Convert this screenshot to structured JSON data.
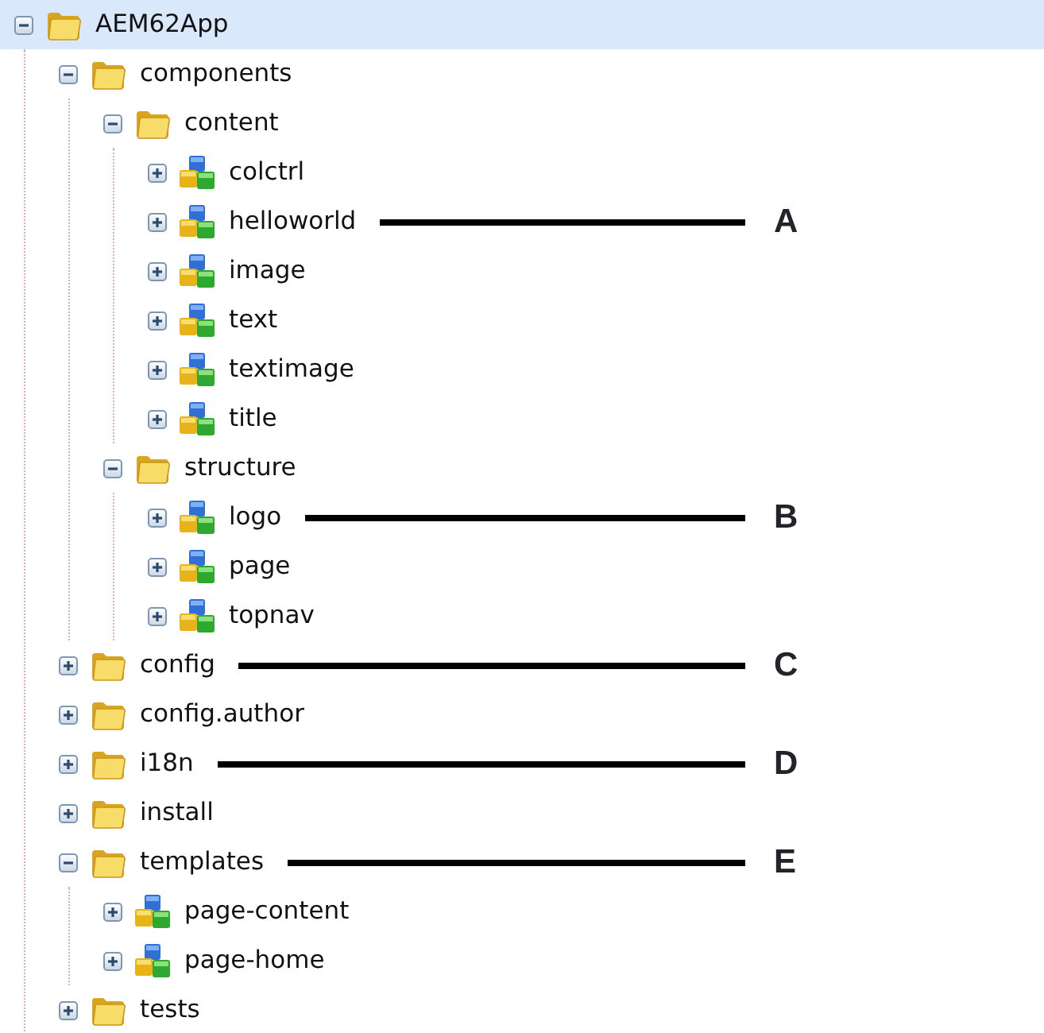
{
  "tree": [
    {
      "label": "AEM62App",
      "kind": "folder",
      "expanded": true,
      "selected": true,
      "children": [
        {
          "label": "components",
          "kind": "folder",
          "expanded": true,
          "selected": false,
          "children": [
            {
              "label": "content",
              "kind": "folder",
              "expanded": true,
              "selected": false,
              "children": [
                {
                  "label": "colctrl",
                  "kind": "component",
                  "expanded": false,
                  "selected": false
                },
                {
                  "label": "helloworld",
                  "kind": "component",
                  "expanded": false,
                  "selected": false,
                  "annotation": "A"
                },
                {
                  "label": "image",
                  "kind": "component",
                  "expanded": false,
                  "selected": false
                },
                {
                  "label": "text",
                  "kind": "component",
                  "expanded": false,
                  "selected": false
                },
                {
                  "label": "textimage",
                  "kind": "component",
                  "expanded": false,
                  "selected": false
                },
                {
                  "label": "title",
                  "kind": "component",
                  "expanded": false,
                  "selected": false
                }
              ]
            },
            {
              "label": "structure",
              "kind": "folder",
              "expanded": true,
              "selected": false,
              "children": [
                {
                  "label": "logo",
                  "kind": "component",
                  "expanded": false,
                  "selected": false,
                  "annotation": "B"
                },
                {
                  "label": "page",
                  "kind": "component",
                  "expanded": false,
                  "selected": false
                },
                {
                  "label": "topnav",
                  "kind": "component",
                  "expanded": false,
                  "selected": false
                }
              ]
            }
          ]
        },
        {
          "label": "config",
          "kind": "folder",
          "expanded": false,
          "selected": false,
          "annotation": "C"
        },
        {
          "label": "config.author",
          "kind": "folder",
          "expanded": false,
          "selected": false
        },
        {
          "label": "i18n",
          "kind": "folder",
          "expanded": false,
          "selected": false,
          "annotation": "D"
        },
        {
          "label": "install",
          "kind": "folder",
          "expanded": false,
          "selected": false
        },
        {
          "label": "templates",
          "kind": "folder",
          "expanded": true,
          "selected": false,
          "annotation": "E",
          "children": [
            {
              "label": "page-content",
              "kind": "component",
              "expanded": false,
              "selected": false
            },
            {
              "label": "page-home",
              "kind": "component",
              "expanded": false,
              "selected": false
            }
          ]
        },
        {
          "label": "tests",
          "kind": "folder",
          "expanded": false,
          "selected": false
        }
      ]
    }
  ]
}
